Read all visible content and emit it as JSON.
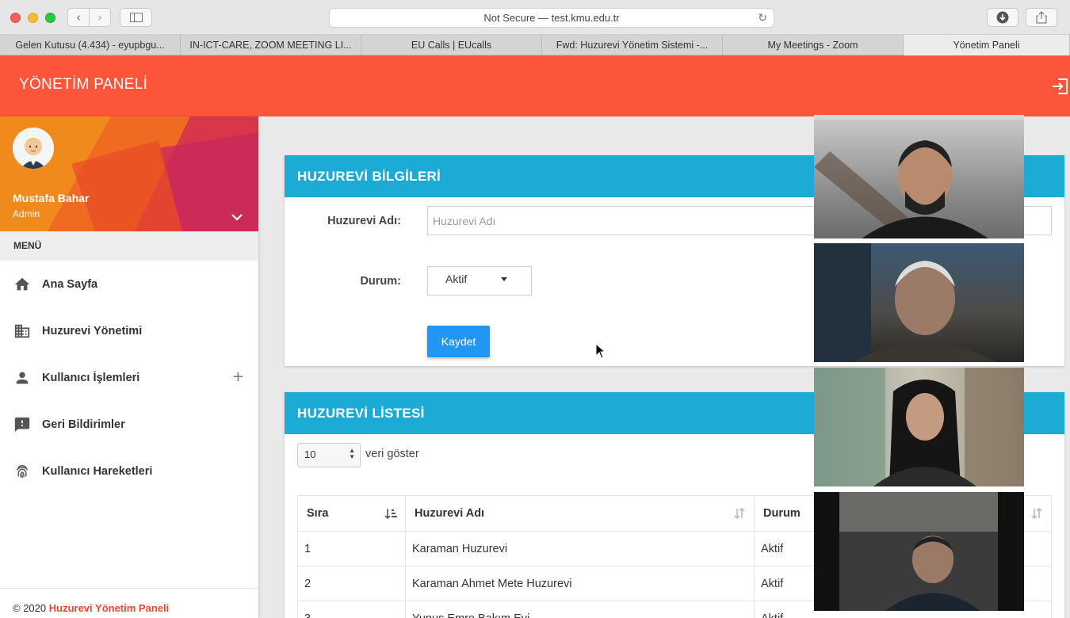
{
  "browser": {
    "url_text": "Not Secure — test.kmu.edu.tr",
    "tabs": [
      {
        "label": "Gelen Kutusu (4.434) - eyupbgu..."
      },
      {
        "label": "IN-ICT-CARE, ZOOM MEETING LI..."
      },
      {
        "label": "EU Calls | EUcalls"
      },
      {
        "label": "Fwd: Huzurevi Yönetim Sistemi -..."
      },
      {
        "label": "My Meetings - Zoom"
      },
      {
        "label": "Yönetim Paneli"
      }
    ]
  },
  "header": {
    "title": "YÖNETİM PANELİ",
    "accent_color": "#fd553a"
  },
  "sidebar": {
    "user_name": "Mustafa Bahar",
    "user_role": "Admin",
    "menu_title": "MENÜ",
    "items": [
      {
        "label": "Ana Sayfa",
        "icon": "home-icon"
      },
      {
        "label": "Huzurevi Yönetimi",
        "icon": "building-icon"
      },
      {
        "label": "Kullanıcı İşlemleri",
        "icon": "person-icon"
      },
      {
        "label": "Geri Bildirimler",
        "icon": "feedback-icon"
      },
      {
        "label": "Kullanıcı Hareketleri",
        "icon": "fingerprint-icon"
      }
    ],
    "expand_symbol": "+"
  },
  "form_card": {
    "title": "HUZUREVİ BİLGİLERİ",
    "name_label": "Huzurevi Adı:",
    "name_placeholder": "Huzurevi Adı",
    "status_label": "Durum:",
    "status_value": "Aktif",
    "save_label": "Kaydet",
    "header_color": "#1cabd4"
  },
  "list_card": {
    "title": "HUZUREVİ LİSTESİ",
    "page_length": "10",
    "page_length_label": "veri göster",
    "columns": [
      "Sıra",
      "Huzurevi Adı",
      "Durum"
    ],
    "rows": [
      {
        "no": "1",
        "name": "Karaman Huzurevi",
        "status": "Aktif"
      },
      {
        "no": "2",
        "name": "Karaman Ahmet Mete Huzurevi",
        "status": "Aktif"
      },
      {
        "no": "3",
        "name": "Yunus Emre Bakım Evi",
        "status": "Aktif"
      }
    ]
  },
  "footer": {
    "copyright": "© 2020",
    "brand": "Huzurevi Yönetim Paneli"
  },
  "video_tiles": [
    {
      "icon": "participant-video"
    },
    {
      "icon": "participant-video"
    },
    {
      "icon": "participant-video"
    },
    {
      "icon": "participant-video"
    }
  ]
}
